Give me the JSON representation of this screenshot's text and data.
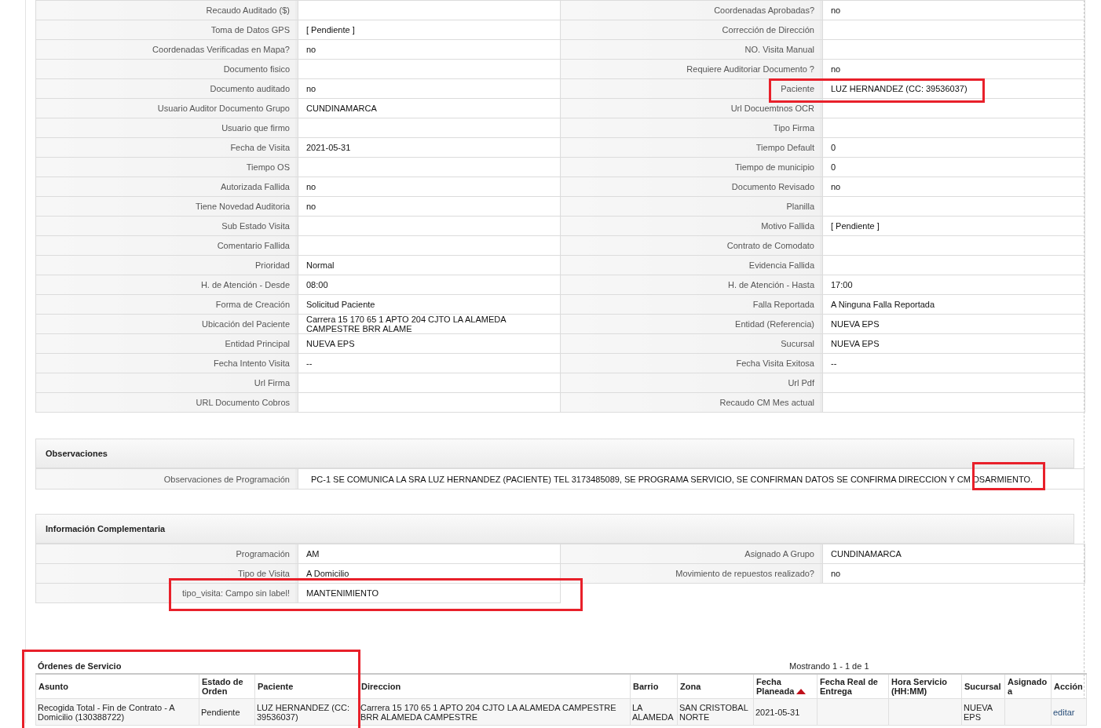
{
  "details": {
    "rows": [
      [
        {
          "label": "Recaudo Auditado ($)"
        },
        {
          "label": "Coordenadas Aprobadas?",
          "value": "no"
        }
      ],
      [
        {
          "label": "Toma de Datos GPS",
          "value": "[ Pendiente ]"
        },
        {
          "label": "Corrección de Dirección"
        }
      ],
      [
        {
          "label": "Coordenadas Verificadas en Mapa?",
          "value": "no"
        },
        {
          "label": "NO. Visita Manual"
        }
      ],
      [
        {
          "label": "Documento fisico"
        },
        {
          "label": "Requiere Auditoriar Documento ?",
          "value": "no"
        }
      ],
      [
        {
          "label": "Documento auditado",
          "value": "no"
        },
        {
          "label": "Paciente",
          "value": "LUZ HERNANDEZ (CC: 39536037)"
        }
      ],
      [
        {
          "label": "Usuario Auditor Documento Grupo",
          "value": "CUNDINAMARCA"
        },
        {
          "label": "Url Docuemtnos OCR"
        }
      ],
      [
        {
          "label": "Usuario que firmo"
        },
        {
          "label": "Tipo Firma"
        }
      ],
      [
        {
          "label": "Fecha de Visita",
          "value": "2021-05-31"
        },
        {
          "label": "Tiempo Default",
          "value": "0"
        }
      ],
      [
        {
          "label": "Tiempo OS"
        },
        {
          "label": "Tiempo de municipio",
          "value": "0"
        }
      ],
      [
        {
          "label": "Autorizada Fallida",
          "value": "no"
        },
        {
          "label": "Documento Revisado",
          "value": "no"
        }
      ],
      [
        {
          "label": "Tiene Novedad Auditoria",
          "value": "no"
        },
        {
          "label": "Planilla"
        }
      ],
      [
        {
          "label": "Sub Estado Visita"
        },
        {
          "label": "Motivo Fallida",
          "value": "[ Pendiente ]"
        }
      ],
      [
        {
          "label": "Comentario Fallida"
        },
        {
          "label": "Contrato de Comodato"
        }
      ],
      [
        {
          "label": "Prioridad",
          "value": "Normal"
        },
        {
          "label": "Evidencia Fallida"
        }
      ],
      [
        {
          "label": "H. de Atención - Desde",
          "value": "08:00"
        },
        {
          "label": "H. de Atención - Hasta",
          "value": "17:00"
        }
      ],
      [
        {
          "label": "Forma de Creación",
          "value": "Solicitud Paciente"
        },
        {
          "label": "Falla Reportada",
          "value": "A Ninguna Falla Reportada"
        }
      ],
      [
        {
          "label": "Ubicación del Paciente",
          "value": "Carrera 15 170 65 1 APTO 204 CJTO LA ALAMEDA CAMPESTRE BRR ALAME"
        },
        {
          "label": "Entidad (Referencia)",
          "value": "NUEVA EPS"
        }
      ],
      [
        {
          "label": "Entidad Principal",
          "value": "NUEVA EPS"
        },
        {
          "label": "Sucursal",
          "value": "NUEVA EPS"
        }
      ],
      [
        {
          "label": "Fecha Intento Visita",
          "value": "--"
        },
        {
          "label": "Fecha Visita Exitosa",
          "value": "--"
        }
      ],
      [
        {
          "label": "Url Firma"
        },
        {
          "label": "Url Pdf"
        }
      ],
      [
        {
          "label": "URL Documento Cobros"
        },
        {
          "label": "Recaudo CM Mes actual"
        }
      ]
    ]
  },
  "observaciones": {
    "title": "Observaciones",
    "label": "Observaciones de Programación",
    "value": "PC-1 SE COMUNICA LA SRA LUZ HERNANDEZ (PACIENTE) TEL 3173485089, SE PROGRAMA SERVICIO, SE CONFIRMAN DATOS SE CONFIRMA DIRECCION Y CM DSARMIENTO."
  },
  "info": {
    "title": "Información Complementaria",
    "rows": [
      [
        {
          "label": "Programación",
          "value": "AM"
        },
        {
          "label": "Asignado A Grupo",
          "value": "CUNDINAMARCA"
        }
      ],
      [
        {
          "label": "Tipo de Visita",
          "value": "A Domicilio"
        },
        {
          "label": "Movimiento de repuestos realizado?",
          "value": "no"
        }
      ],
      [
        {
          "label": "tipo_visita: Campo sin label!",
          "value": "MANTENIMIENTO"
        }
      ]
    ]
  },
  "orders": {
    "title": "Órdenes de Servicio",
    "pagination": "Mostrando 1 - 1 de 1",
    "columns": [
      {
        "label": "Asunto",
        "sorted_ascending": false
      },
      {
        "label": "Estado de Orden",
        "sorted_ascending": false
      },
      {
        "label": "Paciente",
        "sorted_ascending": false
      },
      {
        "label": "Direccion",
        "sorted_ascending": false
      },
      {
        "label": "Barrio",
        "sorted_ascending": false
      },
      {
        "label": "Zona",
        "sorted_ascending": false
      },
      {
        "label": "Fecha Planeada",
        "sorted_ascending": true
      },
      {
        "label": "Fecha Real de Entrega",
        "sorted_ascending": false
      },
      {
        "label": "Hora Servicio (HH:MM)",
        "sorted_ascending": false
      },
      {
        "label": "Sucursal",
        "sorted_ascending": false
      },
      {
        "label": "Asignado a",
        "sorted_ascending": false
      },
      {
        "label": "Acción",
        "sorted_ascending": false
      }
    ],
    "rows": [
      {
        "cells": [
          "Recogida Total - Fin de Contrato - A Domicilio (130388722)",
          "Pendiente",
          "LUZ HERNANDEZ (CC: 39536037)",
          "Carrera 15 170 65 1 APTO 204 CJTO LA ALAMEDA CAMPESTRE BRR ALAMEDA CAMPESTRE",
          "LA ALAMEDA",
          "SAN CRISTOBAL NORTE",
          "2021-05-31",
          null,
          null,
          "NUEVA EPS",
          null
        ],
        "action": "editar"
      }
    ]
  }
}
